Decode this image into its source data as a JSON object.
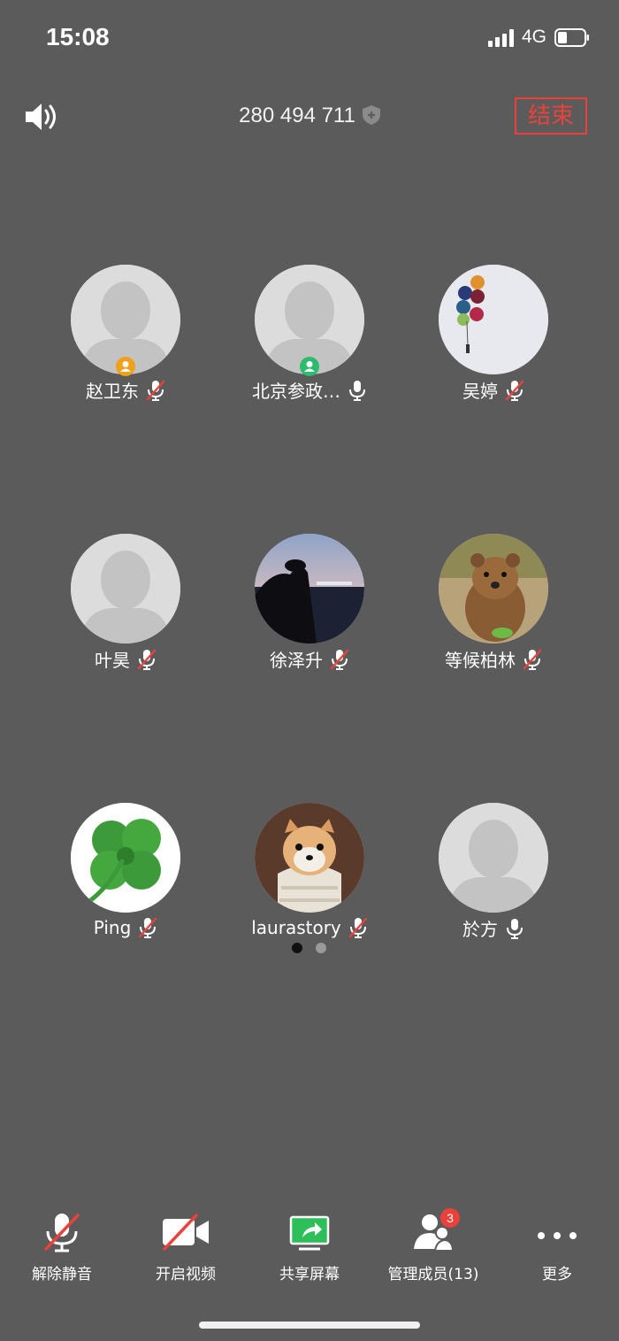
{
  "status_bar": {
    "time": "15:08",
    "network": "4G"
  },
  "header": {
    "meeting_id": "280 494 711",
    "end_label": "结束"
  },
  "colors": {
    "background": "#5b5b5b",
    "end_red": "#e8423a",
    "host_badge": "#f0a11c",
    "cohost_badge": "#2dbb6e",
    "share_green": "#2fbf5a"
  },
  "participants": [
    {
      "name": "赵卫东",
      "avatar": "default-avatar",
      "role": "host",
      "mic": "muted"
    },
    {
      "name": "北京参政…",
      "avatar": "default-avatar",
      "role": "cohost",
      "mic": "on"
    },
    {
      "name": "吴婷",
      "avatar": "balloons-photo",
      "mic": "muted"
    },
    {
      "name": "叶昊",
      "avatar": "default-avatar",
      "mic": "muted"
    },
    {
      "name": "徐泽升",
      "avatar": "night-sea-photo",
      "mic": "muted"
    },
    {
      "name": "等候柏林",
      "avatar": "quokka-photo",
      "mic": "muted"
    },
    {
      "name": "Ping",
      "avatar": "four-leaf-clover",
      "mic": "muted"
    },
    {
      "name": "laurastory",
      "avatar": "dog-in-blanket-photo",
      "mic": "muted"
    },
    {
      "name": "於方",
      "avatar": "default-avatar",
      "mic": "on"
    }
  ],
  "pagination": {
    "pages": 2,
    "current": 1
  },
  "toolbar": {
    "unmute": "解除静音",
    "start_video": "开启视频",
    "share_screen": "共享屏幕",
    "manage_members": "管理成员(13)",
    "manage_badge": "3",
    "more": "更多"
  }
}
